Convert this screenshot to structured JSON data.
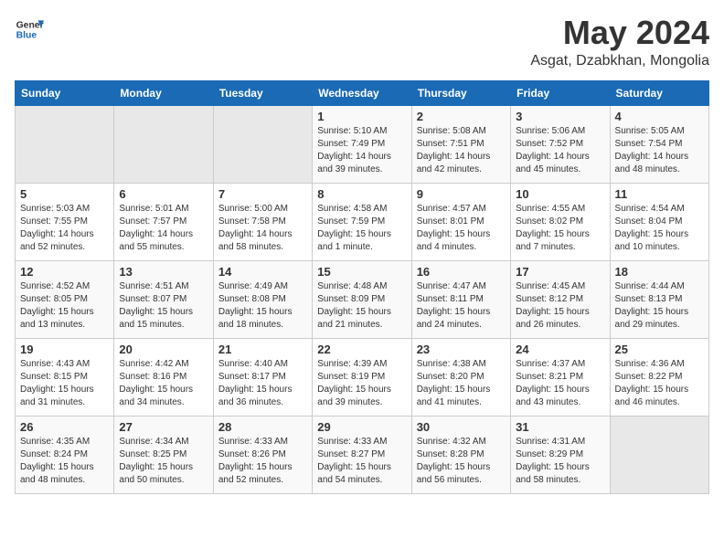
{
  "header": {
    "logo_line1": "General",
    "logo_line2": "Blue",
    "month": "May 2024",
    "location": "Asgat, Dzabkhan, Mongolia"
  },
  "weekdays": [
    "Sunday",
    "Monday",
    "Tuesday",
    "Wednesday",
    "Thursday",
    "Friday",
    "Saturday"
  ],
  "weeks": [
    [
      {
        "day": "",
        "info": ""
      },
      {
        "day": "",
        "info": ""
      },
      {
        "day": "",
        "info": ""
      },
      {
        "day": "1",
        "info": "Sunrise: 5:10 AM\nSunset: 7:49 PM\nDaylight: 14 hours\nand 39 minutes."
      },
      {
        "day": "2",
        "info": "Sunrise: 5:08 AM\nSunset: 7:51 PM\nDaylight: 14 hours\nand 42 minutes."
      },
      {
        "day": "3",
        "info": "Sunrise: 5:06 AM\nSunset: 7:52 PM\nDaylight: 14 hours\nand 45 minutes."
      },
      {
        "day": "4",
        "info": "Sunrise: 5:05 AM\nSunset: 7:54 PM\nDaylight: 14 hours\nand 48 minutes."
      }
    ],
    [
      {
        "day": "5",
        "info": "Sunrise: 5:03 AM\nSunset: 7:55 PM\nDaylight: 14 hours\nand 52 minutes."
      },
      {
        "day": "6",
        "info": "Sunrise: 5:01 AM\nSunset: 7:57 PM\nDaylight: 14 hours\nand 55 minutes."
      },
      {
        "day": "7",
        "info": "Sunrise: 5:00 AM\nSunset: 7:58 PM\nDaylight: 14 hours\nand 58 minutes."
      },
      {
        "day": "8",
        "info": "Sunrise: 4:58 AM\nSunset: 7:59 PM\nDaylight: 15 hours\nand 1 minute."
      },
      {
        "day": "9",
        "info": "Sunrise: 4:57 AM\nSunset: 8:01 PM\nDaylight: 15 hours\nand 4 minutes."
      },
      {
        "day": "10",
        "info": "Sunrise: 4:55 AM\nSunset: 8:02 PM\nDaylight: 15 hours\nand 7 minutes."
      },
      {
        "day": "11",
        "info": "Sunrise: 4:54 AM\nSunset: 8:04 PM\nDaylight: 15 hours\nand 10 minutes."
      }
    ],
    [
      {
        "day": "12",
        "info": "Sunrise: 4:52 AM\nSunset: 8:05 PM\nDaylight: 15 hours\nand 13 minutes."
      },
      {
        "day": "13",
        "info": "Sunrise: 4:51 AM\nSunset: 8:07 PM\nDaylight: 15 hours\nand 15 minutes."
      },
      {
        "day": "14",
        "info": "Sunrise: 4:49 AM\nSunset: 8:08 PM\nDaylight: 15 hours\nand 18 minutes."
      },
      {
        "day": "15",
        "info": "Sunrise: 4:48 AM\nSunset: 8:09 PM\nDaylight: 15 hours\nand 21 minutes."
      },
      {
        "day": "16",
        "info": "Sunrise: 4:47 AM\nSunset: 8:11 PM\nDaylight: 15 hours\nand 24 minutes."
      },
      {
        "day": "17",
        "info": "Sunrise: 4:45 AM\nSunset: 8:12 PM\nDaylight: 15 hours\nand 26 minutes."
      },
      {
        "day": "18",
        "info": "Sunrise: 4:44 AM\nSunset: 8:13 PM\nDaylight: 15 hours\nand 29 minutes."
      }
    ],
    [
      {
        "day": "19",
        "info": "Sunrise: 4:43 AM\nSunset: 8:15 PM\nDaylight: 15 hours\nand 31 minutes."
      },
      {
        "day": "20",
        "info": "Sunrise: 4:42 AM\nSunset: 8:16 PM\nDaylight: 15 hours\nand 34 minutes."
      },
      {
        "day": "21",
        "info": "Sunrise: 4:40 AM\nSunset: 8:17 PM\nDaylight: 15 hours\nand 36 minutes."
      },
      {
        "day": "22",
        "info": "Sunrise: 4:39 AM\nSunset: 8:19 PM\nDaylight: 15 hours\nand 39 minutes."
      },
      {
        "day": "23",
        "info": "Sunrise: 4:38 AM\nSunset: 8:20 PM\nDaylight: 15 hours\nand 41 minutes."
      },
      {
        "day": "24",
        "info": "Sunrise: 4:37 AM\nSunset: 8:21 PM\nDaylight: 15 hours\nand 43 minutes."
      },
      {
        "day": "25",
        "info": "Sunrise: 4:36 AM\nSunset: 8:22 PM\nDaylight: 15 hours\nand 46 minutes."
      }
    ],
    [
      {
        "day": "26",
        "info": "Sunrise: 4:35 AM\nSunset: 8:24 PM\nDaylight: 15 hours\nand 48 minutes."
      },
      {
        "day": "27",
        "info": "Sunrise: 4:34 AM\nSunset: 8:25 PM\nDaylight: 15 hours\nand 50 minutes."
      },
      {
        "day": "28",
        "info": "Sunrise: 4:33 AM\nSunset: 8:26 PM\nDaylight: 15 hours\nand 52 minutes."
      },
      {
        "day": "29",
        "info": "Sunrise: 4:33 AM\nSunset: 8:27 PM\nDaylight: 15 hours\nand 54 minutes."
      },
      {
        "day": "30",
        "info": "Sunrise: 4:32 AM\nSunset: 8:28 PM\nDaylight: 15 hours\nand 56 minutes."
      },
      {
        "day": "31",
        "info": "Sunrise: 4:31 AM\nSunset: 8:29 PM\nDaylight: 15 hours\nand 58 minutes."
      },
      {
        "day": "",
        "info": ""
      }
    ]
  ]
}
